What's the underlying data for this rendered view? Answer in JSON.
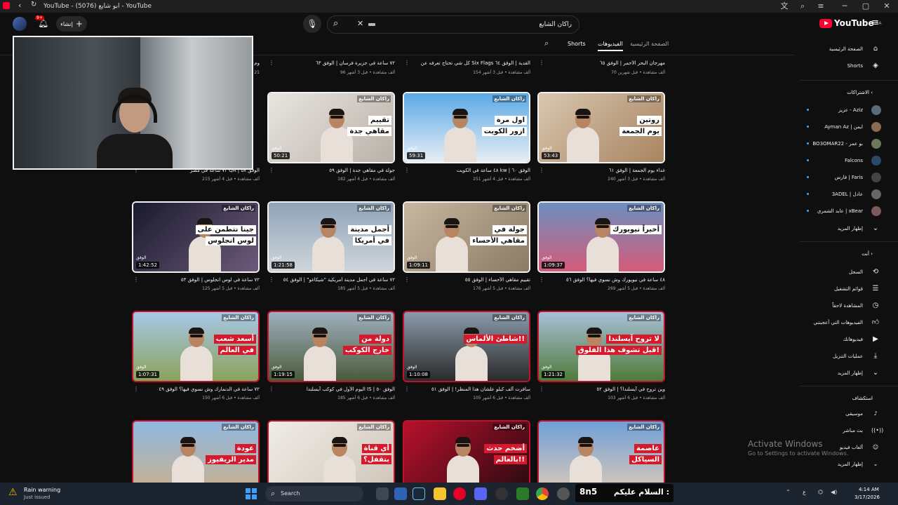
{
  "window": {
    "title": "YouTube - (5076) ابو شايع - YouTube",
    "controls": [
      "─",
      "▢",
      "✕"
    ]
  },
  "masthead": {
    "search_value": "راكان الشايع",
    "create_label": "إنشاء",
    "notif_count": "9+",
    "logo_text": "YouTube",
    "logo_country": "SA"
  },
  "tabs": {
    "home": "الصفحة الرئيسية",
    "videos": "الفيديوهات",
    "shorts": "Shorts"
  },
  "top_row": [
    {
      "title": "مهرجان البحر الأحمر | الوفق ٦٥",
      "meta": "70 ألف مشاهدة • قبل شهرين"
    },
    {
      "title": "كل شي تحتاج تعرفه عن Six Flags القدية | الوفق ٦٤",
      "meta": "154 ألف مشاهدة • قبل 3 أشهر"
    },
    {
      "title": "٧٢ ساعة في جزيرة فرسان | الوفق ٦٣",
      "meta": "96 ألف مشاهدة • قبل 3 أشهر"
    },
    {
      "title": "وم",
      "meta": "21"
    }
  ],
  "videos": [
    {
      "title": "غداء يوم الجمعة | الوفق ٦١",
      "meta": "240 ألف مشاهدة • قبل 3 أشهر",
      "duration": "53:43",
      "tag1": "روتين",
      "tag2": "يوم الجمعة",
      "brand": "راكان الشايع",
      "red": false
    },
    {
      "title": "٤٨ ساعة في الكويت kw | الوفق ٦٠",
      "meta": "251 ألف مشاهدة • قبل 4 أشهر",
      "duration": "59:31",
      "tag1": "اول مرة",
      "tag2": "ازور الكويت",
      "brand": "راكان الشايع",
      "red": false
    },
    {
      "title": "جولة في مقاهي جدة | الوفق ٥٩",
      "meta": "182 ألف مشاهدة • قبل 4 أشهر",
      "duration": "50:21",
      "tag1": "تقييم",
      "tag2": "مقاهي جدة",
      "brand": "راكان الشايع",
      "red": false
    },
    {
      "title": "٧٢ ساعة في مصر QA | الوفق ٥٨",
      "meta": "215 ألف مشاهدة • قبل 4 أشهر",
      "duration": "",
      "tag1": "",
      "tag2": "",
      "brand": "",
      "red": false
    },
    {
      "title": "٤٨ ساعة في نيويورك وش نسوي فيها؟ الوفق ٥٦",
      "meta": "269 ألف مشاهدة • قبل 5 أشهر",
      "duration": "1:09:37",
      "tag1": "أخيراً نيويورك",
      "tag2": "",
      "brand": "راكان الشايع",
      "red": false
    },
    {
      "title": "تقييم مقاهي الأحساء | الوفق ٥٥",
      "meta": "176 ألف مشاهدة • قبل 5 أشهر",
      "duration": "1:09:11",
      "tag1": "جولة في",
      "tag2": "مقاهي الأحساء",
      "brand": "راكان الشايع",
      "red": false
    },
    {
      "title": "٧٢ ساعة في أجمل مدينة أمريكية \"شيكاغو\" | الوفق ٥٤",
      "meta": "185 ألف مشاهدة • قبل 5 أشهر",
      "duration": "1:21:58",
      "tag1": "أجمل مدينة",
      "tag2": "في أمريكا",
      "brand": "راكان الشايع",
      "red": false
    },
    {
      "title": "٧٢ ساعة في لوس انجلوس | الوفق ٥٣",
      "meta": "125 ألف مشاهدة • قبل 5 أشهر",
      "duration": "1:42:52",
      "tag1": "جينا نتطمن على",
      "tag2": "لوس انجلوس",
      "brand": "راكان الشايع",
      "red": false
    },
    {
      "title": "وين تروح في آيسلندا؟ | الوفق ٥٢",
      "meta": "103 ألف مشاهدة • قبل 6 أشهر",
      "duration": "1:21:32",
      "tag1": "لا تروح آيسلندا",
      "tag2": "قبل تشوف هذا الفلوق!",
      "brand": "راكان الشايع",
      "red": true
    },
    {
      "title": "سافرت آلف كيلو علشان هذا المنظر! | الوفق ٥١",
      "meta": "105 ألف مشاهدة • قبل 6 أشهر",
      "duration": "1:10:08",
      "tag1": "شاطئ الألماس!!",
      "tag2": "",
      "brand": "راكان الشايع",
      "red": true
    },
    {
      "title": "اليوم الأول في كوكب آيسلندا IS | الوفق ٥٠",
      "meta": "185 ألف مشاهدة • قبل 6 أشهر",
      "duration": "1:19:15",
      "tag1": "دولة من",
      "tag2": "خارج الكوكب",
      "brand": "راكان الشايع",
      "red": true
    },
    {
      "title": "٧٢ ساعة في الدنمارك وش نسوي فيها؟ الوفق ٤٩",
      "meta": "150 ألف مشاهدة • قبل 6 أشهر",
      "duration": "1:07:31",
      "tag1": "أسعد شعب",
      "tag2": "في العالم",
      "brand": "راكان الشايع",
      "red": true
    },
    {
      "title": "",
      "meta": "",
      "duration": "",
      "tag1": "عاصمة",
      "tag2": "السياكل",
      "brand": "راكان الشايع",
      "red": true
    },
    {
      "title": "",
      "meta": "",
      "duration": "",
      "tag1": "أضخم حدث",
      "tag2": "بالعالم!!",
      "brand": "راكان الشايع",
      "red": true
    },
    {
      "title": "",
      "meta": "",
      "duration": "",
      "tag1": "أي قناة",
      "tag2": "بتقفل؟",
      "brand": "راكان الشايع",
      "red": true
    },
    {
      "title": "",
      "meta": "",
      "duration": "",
      "tag1": "عودة",
      "tag2": "مدير الريفيوز",
      "brand": "راكان الشايع",
      "red": true
    }
  ],
  "thumb_label": "الوفق",
  "sidebar": {
    "home": "الصفحة الرئيسية",
    "shorts": "Shorts",
    "subs_head": "الاشتراكات",
    "subs": [
      {
        "name": "عزيز - Aziz",
        "color": "#5a6b7a"
      },
      {
        "name": "Ayman Az | ايمن",
        "color": "#8a6a50"
      },
      {
        "name": "BO3OMAR22 - بو عمر",
        "color": "#6c7a5a"
      },
      {
        "name": "Falcons",
        "color": "#2a4a6a"
      },
      {
        "name": "فارس | Faris",
        "color": "#444"
      },
      {
        "name": "3ADEL | عادل",
        "color": "#666"
      },
      {
        "name": "عابد الشمري | xBear",
        "color": "#7a5a5a"
      }
    ],
    "show_more": "إظهار المزيد",
    "you_head": "أنت",
    "you_items": [
      "السجل",
      "قوائم التشغيل",
      "المشاهدة لاحقاً",
      "الفيديوهات التي أعجبتني",
      "فيديوهاتك",
      "عمليات التنزيل",
      "إظهار المزيد"
    ],
    "explore_head": "استكشاف",
    "explore_items": [
      "موسيقى",
      "بث مباشر",
      "ألعاب فيديو",
      "إظهار المزيد"
    ]
  },
  "activate": {
    "line1": "Activate Windows",
    "line2": "Go to Settings to activate Windows."
  },
  "taskbar": {
    "weather_title": "Rain warning",
    "weather_sub": "Just issued",
    "search": "Search",
    "overlay_text": "السلام عليكم :",
    "lang": "ع",
    "time": "4:14 AM",
    "date": "3/17/2026"
  },
  "colors": {
    "accent": "#ff0033",
    "thumb_red": "#c3102c"
  }
}
